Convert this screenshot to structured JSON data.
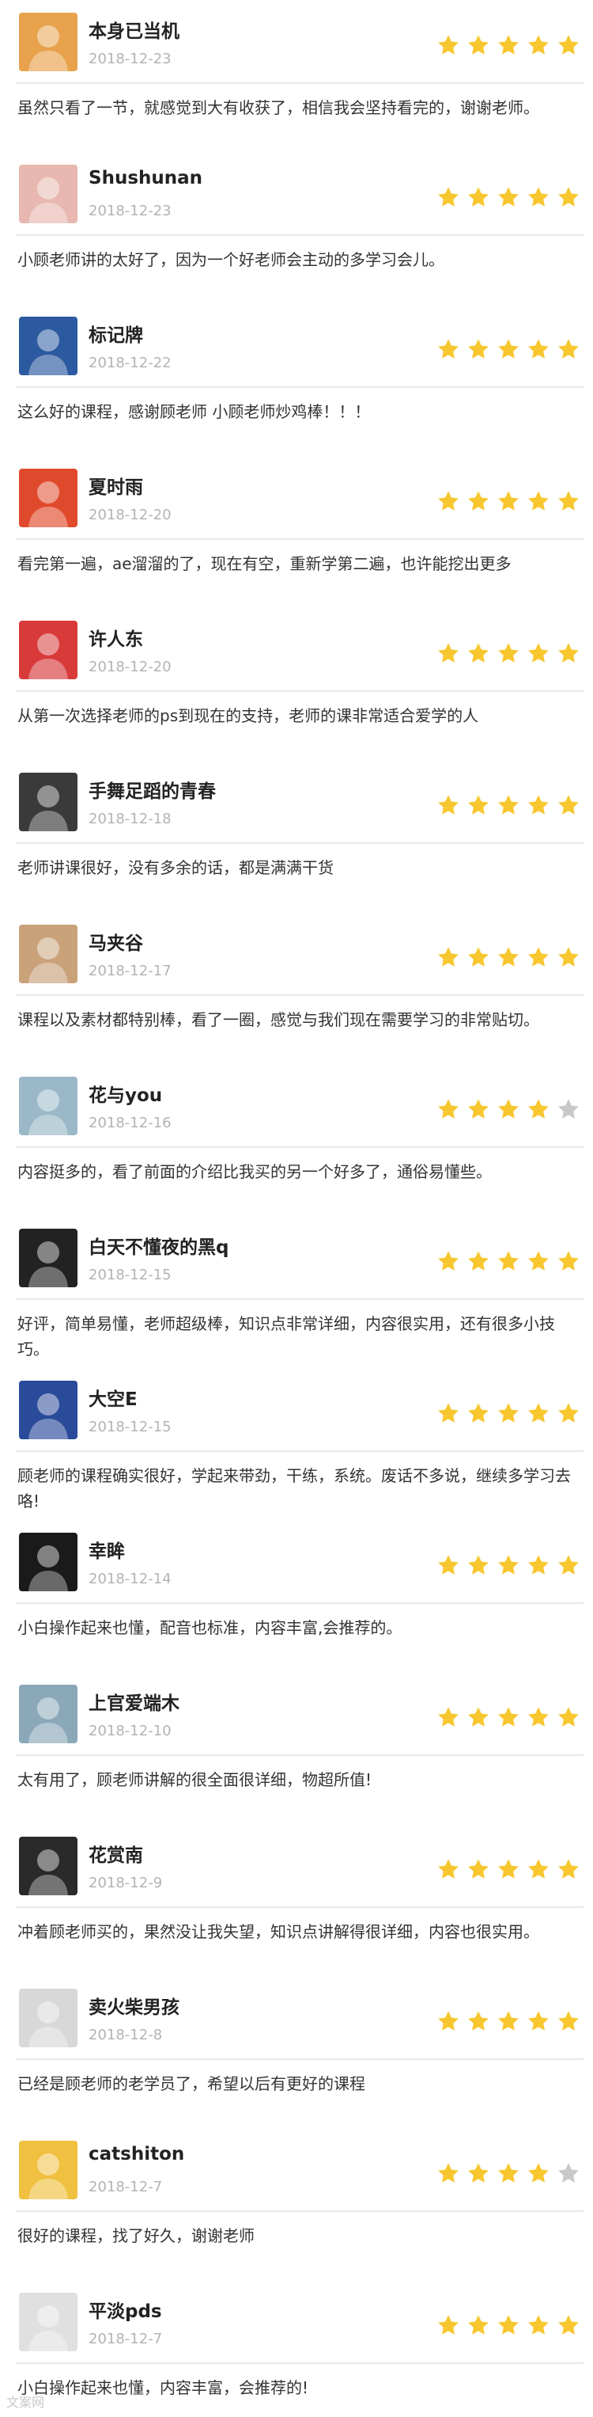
{
  "colors": {
    "star_filled": "#f8c72f",
    "star_empty": "#c8c8c8"
  },
  "reviews": [
    {
      "user": "本身已当机",
      "date": "2018-12-23",
      "rating": 5,
      "avatar_icon": "cartoon-dog-avatar",
      "avatar_color": "#e8a24c",
      "comment": "虽然只看了一节，就感觉到大有收获了，相信我会坚持看完的，谢谢老师。"
    },
    {
      "user": "Shushunan",
      "date": "2018-12-23",
      "rating": 5,
      "avatar_icon": "photo-avatar",
      "avatar_color": "#e8b8b0",
      "comment": "小顾老师讲的太好了，因为一个好老师会主动的多学习会儿。"
    },
    {
      "user": "标记牌",
      "date": "2018-12-22",
      "rating": 5,
      "avatar_icon": "photo-avatar",
      "avatar_color": "#2c5aa0",
      "comment": "这么好的课程，感谢顾老师 小顾老师炒鸡棒！！！"
    },
    {
      "user": "夏时雨",
      "date": "2018-12-20",
      "rating": 5,
      "avatar_icon": "cartoon-face-avatar",
      "avatar_color": "#e04a2c",
      "comment": "看完第一遍，ae溜溜的了，现在有空，重新学第二遍，也许能挖出更多"
    },
    {
      "user": "许人东",
      "date": "2018-12-20",
      "rating": 5,
      "avatar_icon": "cartoon-tiger-avatar",
      "avatar_color": "#d83a3a",
      "comment": "从第一次选择老师的ps到现在的支持，老师的课非常适合爱学的人"
    },
    {
      "user": "手舞足蹈的青春",
      "date": "2018-12-18",
      "rating": 5,
      "avatar_icon": "photo-avatar",
      "avatar_color": "#3a3a3a",
      "comment": "老师讲课很好，没有多余的话，都是满满干货"
    },
    {
      "user": "马夹谷",
      "date": "2018-12-17",
      "rating": 5,
      "avatar_icon": "photo-avatar",
      "avatar_color": "#c9a27a",
      "comment": "课程以及素材都特别棒，看了一圈，感觉与我们现在需要学习的非常贴切。"
    },
    {
      "user": "花与you",
      "date": "2018-12-16",
      "rating": 4,
      "avatar_icon": "photo-avatar",
      "avatar_color": "#9ab8c8",
      "comment": "内容挺多的，看了前面的介绍比我买的另一个好多了，通俗易懂些。"
    },
    {
      "user": "白天不懂夜的黑q",
      "date": "2018-12-15",
      "rating": 5,
      "avatar_icon": "panda-avatar",
      "avatar_color": "#222222",
      "comment": "好评，简单易懂，老师超级棒，知识点非常详细，内容很实用，还有很多小技巧。"
    },
    {
      "user": "大空E",
      "date": "2018-12-15",
      "rating": 5,
      "avatar_icon": "photo-avatar",
      "avatar_color": "#2a4a9a",
      "comment": "顾老师的课程确实很好，学起来带劲，干练，系统。废话不多说，继续多学习去咯!"
    },
    {
      "user": "幸眸",
      "date": "2018-12-14",
      "rating": 5,
      "avatar_icon": "photo-avatar",
      "avatar_color": "#1a1a1a",
      "comment": "小白操作起来也懂，配音也标准，内容丰富,会推荐的。"
    },
    {
      "user": "上官爱端木",
      "date": "2018-12-10",
      "rating": 5,
      "avatar_icon": "photo-avatar",
      "avatar_color": "#8aa8b8",
      "comment": "太有用了，顾老师讲解的很全面很详细，物超所值!"
    },
    {
      "user": "花赏南",
      "date": "2018-12-9",
      "rating": 5,
      "avatar_icon": "dog-photo-avatar",
      "avatar_color": "#2a2a2a",
      "comment": "冲着顾老师买的，果然没让我失望，知识点讲解得很详细，内容也很实用。"
    },
    {
      "user": "卖火柴男孩",
      "date": "2018-12-8",
      "rating": 5,
      "avatar_icon": "photo-avatar",
      "avatar_color": "#d8d8d8",
      "comment": "已经是顾老师的老学员了，希望以后有更好的课程"
    },
    {
      "user": "catshiton",
      "date": "2018-12-7",
      "rating": 4,
      "avatar_icon": "emoji-avatar",
      "avatar_color": "#f0c040",
      "comment": "很好的课程，找了好久，谢谢老师"
    },
    {
      "user": "平淡pds",
      "date": "2018-12-7",
      "rating": 5,
      "avatar_icon": "photo-avatar",
      "avatar_color": "#e0e0e0",
      "comment": "小白操作起来也懂，内容丰富，会推荐的!"
    }
  ],
  "watermark": "文案网"
}
